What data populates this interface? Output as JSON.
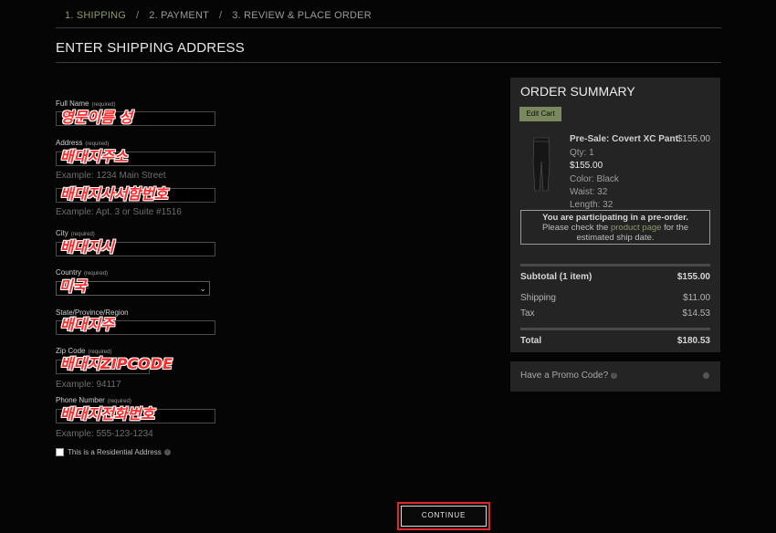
{
  "steps": [
    {
      "label": "1. SHIPPING"
    },
    {
      "label": "2. PAYMENT"
    },
    {
      "label": "3. REVIEW & PLACE ORDER"
    }
  ],
  "step_separator": "/",
  "page_title": "ENTER SHIPPING ADDRESS",
  "required_text": "(required)",
  "form": {
    "full_name": {
      "label": "Full Name",
      "overlay": "영문이름 성"
    },
    "address": {
      "label": "Address",
      "overlay": "배대지주소",
      "example": "Example: 1234 Main Street"
    },
    "address2": {
      "overlay": "배대지사서함번호",
      "example": "Example: Apt. 3 or Suite #1516"
    },
    "city": {
      "label": "City",
      "overlay": "배대지시"
    },
    "country": {
      "label": "Country",
      "overlay": "미국",
      "select_value": "- -"
    },
    "state": {
      "label": "State/Province/Region",
      "overlay": "배대지주"
    },
    "zip": {
      "label": "Zip Code",
      "overlay": "배대지ZIPCODE",
      "example": "Example: 94117"
    },
    "phone": {
      "label": "Phone Number",
      "overlay": "배대지전화번호",
      "example": "Example: 555-123-1234"
    },
    "residential": {
      "label": "This is a Residential Address",
      "checked": false
    }
  },
  "continue_label": "CONTINUE",
  "summary": {
    "title": "ORDER SUMMARY",
    "edit_cart": "Edit Cart",
    "product": {
      "name": "Pre-Sale: Covert XC Pant",
      "price": "$155.00",
      "qty": "Qty: 1",
      "line_price": "$155.00",
      "color": "Color: Black",
      "waist": "Waist: 32",
      "length": "Length: 32"
    },
    "notice": {
      "strong": "You are participating in a pre-order.",
      "pre": "Please check the",
      "link": "product page",
      "post": "for the",
      "tail": "estimated ship date."
    },
    "subtotal_label": "Subtotal (1 item)",
    "subtotal_value": "$155.00",
    "shipping_label": "Shipping",
    "shipping_value": "$11.00",
    "tax_label": "Tax",
    "tax_value": "$14.53",
    "total_label": "Total",
    "total_value": "$180.53"
  },
  "promo_label": "Have a Promo Code?",
  "colors": {
    "accent_green": "#7a8a5e",
    "highlight_red": "#e0262b"
  }
}
